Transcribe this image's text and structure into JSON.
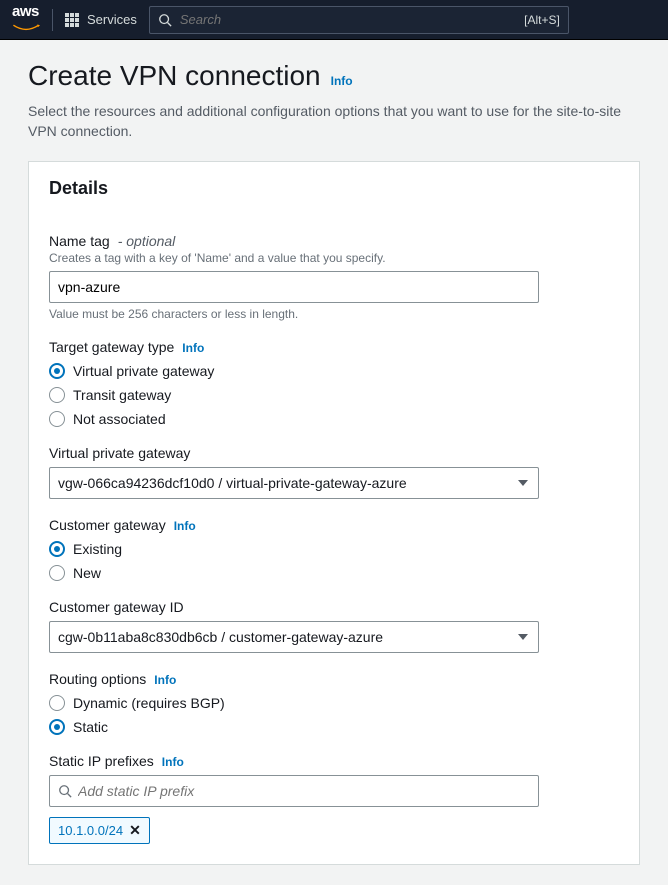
{
  "topnav": {
    "services_label": "Services",
    "search_placeholder": "Search",
    "search_hint": "[Alt+S]"
  },
  "page": {
    "title": "Create VPN connection",
    "info_label": "Info",
    "description": "Select the resources and additional configuration options that you want to use for the site-to-site VPN connection."
  },
  "details": {
    "header": "Details",
    "name_tag": {
      "label": "Name tag",
      "optional": "- optional",
      "sub": "Creates a tag with a key of 'Name' and a value that you specify.",
      "value": "vpn-azure",
      "hint": "Value must be 256 characters or less in length."
    },
    "target_gateway": {
      "label": "Target gateway type",
      "options": {
        "vpg": "Virtual private gateway",
        "tgw": "Transit gateway",
        "none": "Not associated"
      }
    },
    "vpg_select": {
      "label": "Virtual private gateway",
      "value": "vgw-066ca94236dcf10d0 / virtual-private-gateway-azure"
    },
    "customer_gateway": {
      "label": "Customer gateway",
      "options": {
        "existing": "Existing",
        "new": "New"
      }
    },
    "cgw_select": {
      "label": "Customer gateway ID",
      "value": "cgw-0b11aba8c830db6cb / customer-gateway-azure"
    },
    "routing": {
      "label": "Routing options",
      "options": {
        "dynamic": "Dynamic (requires BGP)",
        "static": "Static"
      }
    },
    "static_prefixes": {
      "label": "Static IP prefixes",
      "placeholder": "Add static IP prefix",
      "chips": [
        "10.1.0.0/24"
      ]
    }
  }
}
